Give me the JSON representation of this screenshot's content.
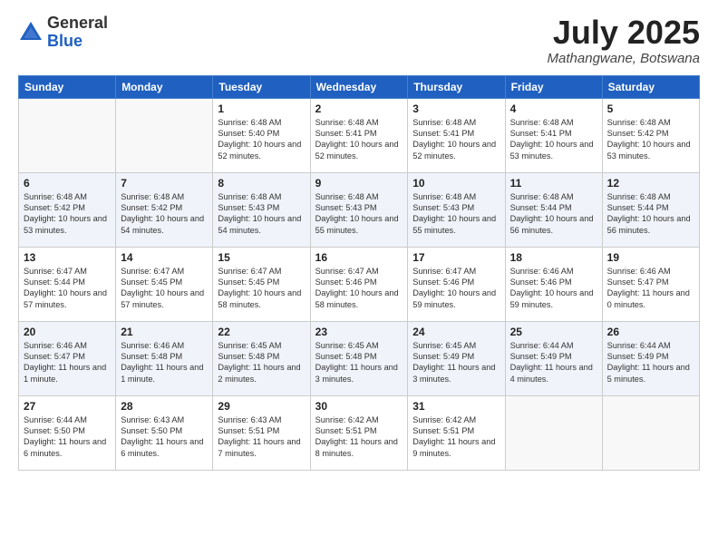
{
  "logo": {
    "general": "General",
    "blue": "Blue"
  },
  "title": "July 2025",
  "location": "Mathangwane, Botswana",
  "days_of_week": [
    "Sunday",
    "Monday",
    "Tuesday",
    "Wednesday",
    "Thursday",
    "Friday",
    "Saturday"
  ],
  "weeks": [
    [
      {
        "day": "",
        "info": ""
      },
      {
        "day": "",
        "info": ""
      },
      {
        "day": "1",
        "info": "Sunrise: 6:48 AM\nSunset: 5:40 PM\nDaylight: 10 hours and 52 minutes."
      },
      {
        "day": "2",
        "info": "Sunrise: 6:48 AM\nSunset: 5:41 PM\nDaylight: 10 hours and 52 minutes."
      },
      {
        "day": "3",
        "info": "Sunrise: 6:48 AM\nSunset: 5:41 PM\nDaylight: 10 hours and 52 minutes."
      },
      {
        "day": "4",
        "info": "Sunrise: 6:48 AM\nSunset: 5:41 PM\nDaylight: 10 hours and 53 minutes."
      },
      {
        "day": "5",
        "info": "Sunrise: 6:48 AM\nSunset: 5:42 PM\nDaylight: 10 hours and 53 minutes."
      }
    ],
    [
      {
        "day": "6",
        "info": "Sunrise: 6:48 AM\nSunset: 5:42 PM\nDaylight: 10 hours and 53 minutes."
      },
      {
        "day": "7",
        "info": "Sunrise: 6:48 AM\nSunset: 5:42 PM\nDaylight: 10 hours and 54 minutes."
      },
      {
        "day": "8",
        "info": "Sunrise: 6:48 AM\nSunset: 5:43 PM\nDaylight: 10 hours and 54 minutes."
      },
      {
        "day": "9",
        "info": "Sunrise: 6:48 AM\nSunset: 5:43 PM\nDaylight: 10 hours and 55 minutes."
      },
      {
        "day": "10",
        "info": "Sunrise: 6:48 AM\nSunset: 5:43 PM\nDaylight: 10 hours and 55 minutes."
      },
      {
        "day": "11",
        "info": "Sunrise: 6:48 AM\nSunset: 5:44 PM\nDaylight: 10 hours and 56 minutes."
      },
      {
        "day": "12",
        "info": "Sunrise: 6:48 AM\nSunset: 5:44 PM\nDaylight: 10 hours and 56 minutes."
      }
    ],
    [
      {
        "day": "13",
        "info": "Sunrise: 6:47 AM\nSunset: 5:44 PM\nDaylight: 10 hours and 57 minutes."
      },
      {
        "day": "14",
        "info": "Sunrise: 6:47 AM\nSunset: 5:45 PM\nDaylight: 10 hours and 57 minutes."
      },
      {
        "day": "15",
        "info": "Sunrise: 6:47 AM\nSunset: 5:45 PM\nDaylight: 10 hours and 58 minutes."
      },
      {
        "day": "16",
        "info": "Sunrise: 6:47 AM\nSunset: 5:46 PM\nDaylight: 10 hours and 58 minutes."
      },
      {
        "day": "17",
        "info": "Sunrise: 6:47 AM\nSunset: 5:46 PM\nDaylight: 10 hours and 59 minutes."
      },
      {
        "day": "18",
        "info": "Sunrise: 6:46 AM\nSunset: 5:46 PM\nDaylight: 10 hours and 59 minutes."
      },
      {
        "day": "19",
        "info": "Sunrise: 6:46 AM\nSunset: 5:47 PM\nDaylight: 11 hours and 0 minutes."
      }
    ],
    [
      {
        "day": "20",
        "info": "Sunrise: 6:46 AM\nSunset: 5:47 PM\nDaylight: 11 hours and 1 minute."
      },
      {
        "day": "21",
        "info": "Sunrise: 6:46 AM\nSunset: 5:48 PM\nDaylight: 11 hours and 1 minute."
      },
      {
        "day": "22",
        "info": "Sunrise: 6:45 AM\nSunset: 5:48 PM\nDaylight: 11 hours and 2 minutes."
      },
      {
        "day": "23",
        "info": "Sunrise: 6:45 AM\nSunset: 5:48 PM\nDaylight: 11 hours and 3 minutes."
      },
      {
        "day": "24",
        "info": "Sunrise: 6:45 AM\nSunset: 5:49 PM\nDaylight: 11 hours and 3 minutes."
      },
      {
        "day": "25",
        "info": "Sunrise: 6:44 AM\nSunset: 5:49 PM\nDaylight: 11 hours and 4 minutes."
      },
      {
        "day": "26",
        "info": "Sunrise: 6:44 AM\nSunset: 5:49 PM\nDaylight: 11 hours and 5 minutes."
      }
    ],
    [
      {
        "day": "27",
        "info": "Sunrise: 6:44 AM\nSunset: 5:50 PM\nDaylight: 11 hours and 6 minutes."
      },
      {
        "day": "28",
        "info": "Sunrise: 6:43 AM\nSunset: 5:50 PM\nDaylight: 11 hours and 6 minutes."
      },
      {
        "day": "29",
        "info": "Sunrise: 6:43 AM\nSunset: 5:51 PM\nDaylight: 11 hours and 7 minutes."
      },
      {
        "day": "30",
        "info": "Sunrise: 6:42 AM\nSunset: 5:51 PM\nDaylight: 11 hours and 8 minutes."
      },
      {
        "day": "31",
        "info": "Sunrise: 6:42 AM\nSunset: 5:51 PM\nDaylight: 11 hours and 9 minutes."
      },
      {
        "day": "",
        "info": ""
      },
      {
        "day": "",
        "info": ""
      }
    ]
  ]
}
